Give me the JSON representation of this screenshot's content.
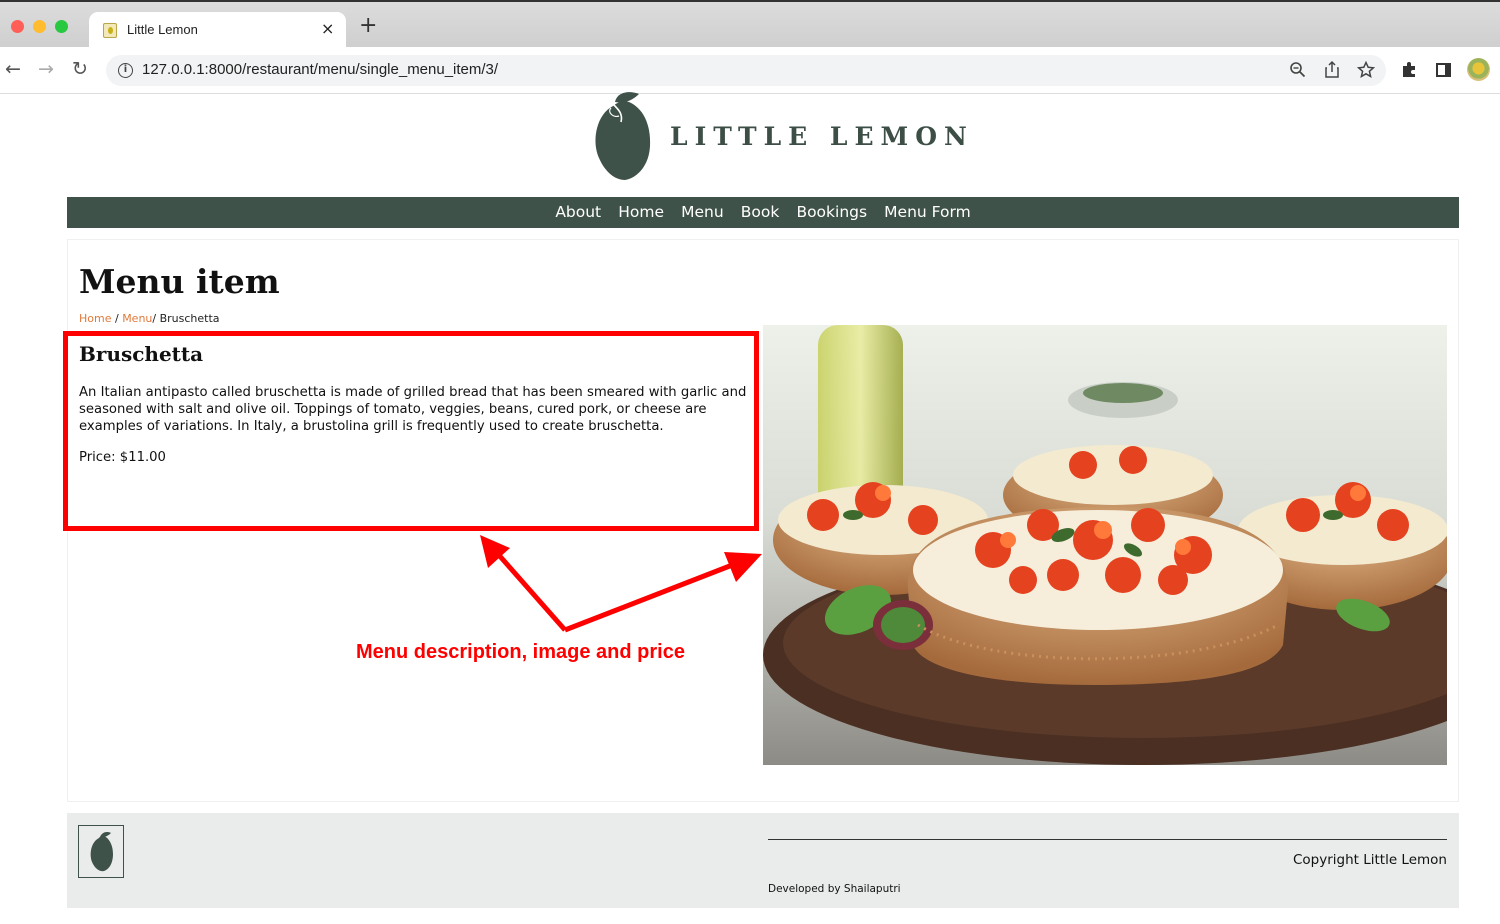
{
  "browser": {
    "tab_title": "Little Lemon",
    "tab_close": "×",
    "new_tab": "+",
    "url": "127.0.0.1:8000/restaurant/menu/single_menu_item/3/",
    "back": "←",
    "forward": "→",
    "reload": "↻"
  },
  "header": {
    "brand": "LITTLE LEMON",
    "nav": [
      "About",
      "Home",
      "Menu",
      "Book",
      "Bookings",
      "Menu Form"
    ]
  },
  "main": {
    "title": "Menu item",
    "breadcrumb": {
      "home": "Home",
      "menu": "Menu",
      "separator": " / ",
      "separator2": "/ ",
      "current": "Bruschetta"
    },
    "item": {
      "name": "Bruschetta",
      "description": "An Italian antipasto called bruschetta is made of grilled bread that has been smeared with garlic and seasoned with salt and olive oil. Toppings of tomato, veggies, beans, cured pork, or cheese are examples of variations. In Italy, a brustolina grill is frequently used to create bruschetta.",
      "price": "Price: $11.00"
    },
    "annotation": "Menu description, image and price"
  },
  "footer": {
    "copyright": "Copyright Little Lemon",
    "developed_by": "Developed by Shailaputri"
  },
  "colors": {
    "brand_green": "#3f5249",
    "link_orange": "#e07a3c",
    "annotation_red": "#ff0000",
    "footer_bg": "#e9eceb"
  }
}
